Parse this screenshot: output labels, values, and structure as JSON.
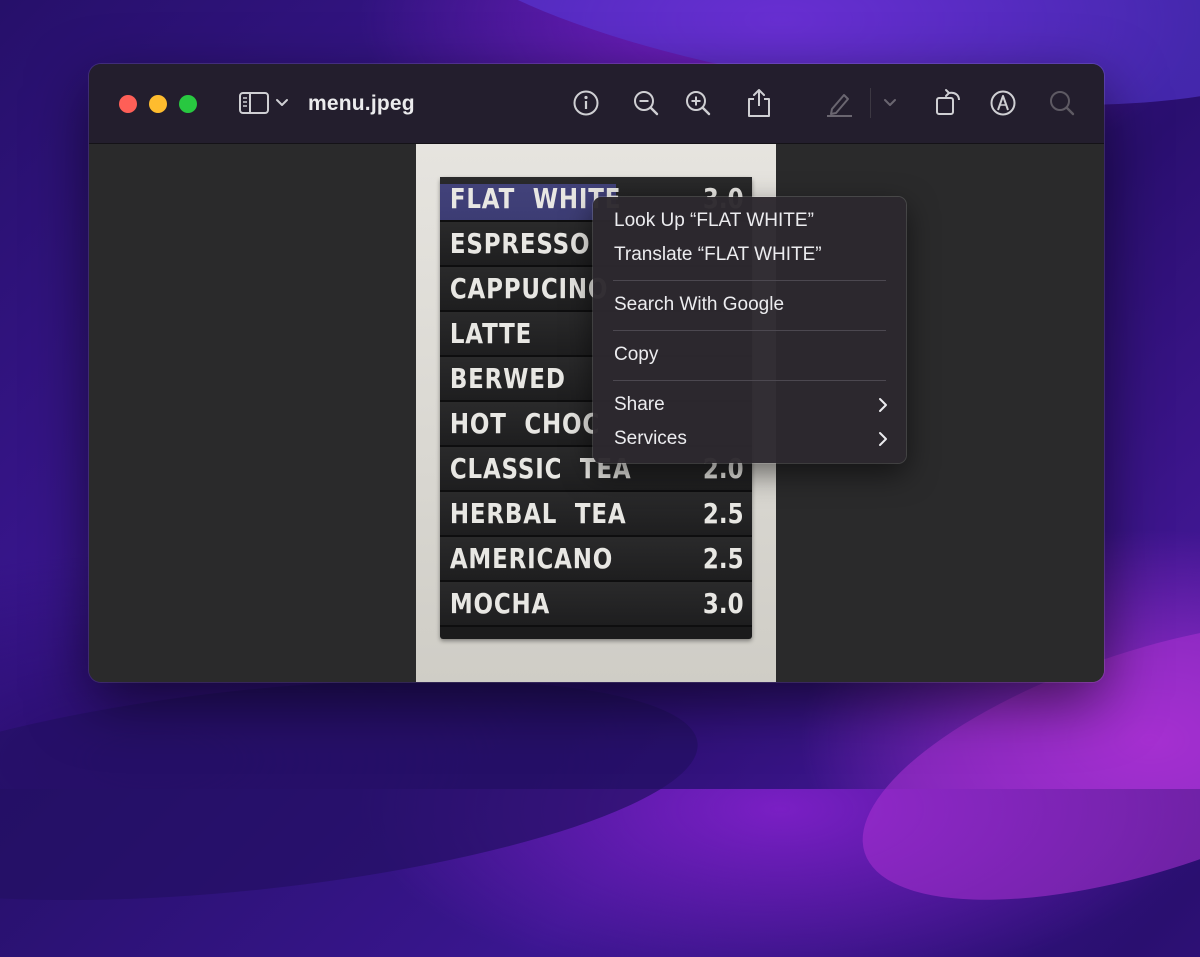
{
  "window": {
    "title": "menu.jpeg",
    "traffic_lights": {
      "close_color": "#fe5f57",
      "minimize_color": "#febc2e",
      "maximize_color": "#28c840"
    }
  },
  "toolbar": {
    "icons": [
      "sidebar-icon",
      "chevron-down-icon",
      "info-icon",
      "zoom-out-icon",
      "zoom-in-icon",
      "share-icon",
      "highlight-icon",
      "chevron-down-icon",
      "rotate-icon",
      "markup-icon",
      "search-icon"
    ]
  },
  "image_content": {
    "menu_items": [
      {
        "name": "FLAT  WHITE",
        "price": "3.0",
        "selected": true
      },
      {
        "name": "ESPRESSO",
        "price": ""
      },
      {
        "name": "CAPPUCINO",
        "price": ""
      },
      {
        "name": "LATTE",
        "price": ""
      },
      {
        "name": "BERWED",
        "price": ""
      },
      {
        "name": "HOT  CHOC",
        "price": ""
      },
      {
        "name": "CLASSIC  TEA",
        "price": "2.0"
      },
      {
        "name": "HERBAL  TEA",
        "price": "2.5"
      },
      {
        "name": "AMERICANO",
        "price": "2.5"
      },
      {
        "name": "MOCHA",
        "price": "3.0"
      }
    ]
  },
  "context_menu": {
    "look_up": "Look Up “FLAT WHITE”",
    "translate": "Translate “FLAT WHITE”",
    "search_google": "Search With Google",
    "copy": "Copy",
    "share": "Share",
    "services": "Services"
  },
  "colors": {
    "selection_highlight": "#6e6eff",
    "toolbar_bg": "#231e2d",
    "window_bg": "#2a2a2b"
  }
}
